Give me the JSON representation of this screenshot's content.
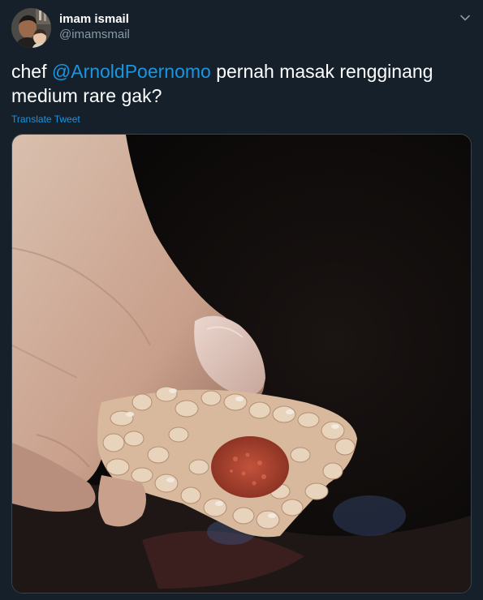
{
  "user": {
    "display_name": "imam ismail",
    "handle": "@imamsmail"
  },
  "tweet": {
    "text_before": "chef ",
    "mention": "@ArnoldPoernomo",
    "text_after": " pernah masak rengginang medium rare gak?",
    "translate_label": "Translate Tweet"
  },
  "icons": {
    "caret": "chevron-down-icon"
  },
  "colors": {
    "background": "#15202b",
    "link": "#1b95e0",
    "secondary_text": "#8899a6",
    "border": "#38444d"
  }
}
